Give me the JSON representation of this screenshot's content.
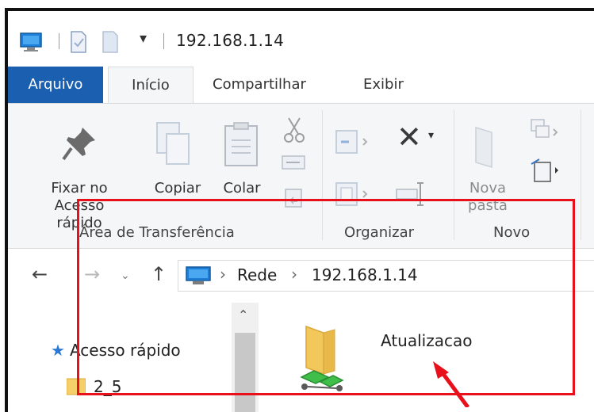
{
  "window": {
    "title": "192.168.1.14"
  },
  "tabs": {
    "file": "Arquivo",
    "home": "Início",
    "share": "Compartilhar",
    "view": "Exibir"
  },
  "ribbon": {
    "pin_line1": "Fixar no",
    "pin_line2": "Acesso rápido",
    "copy": "Copiar",
    "paste": "Colar",
    "new_folder_line1": "Nova",
    "new_folder_line2": "pasta",
    "groups": {
      "clipboard": "Área de Transferência",
      "organize": "Organizar",
      "new": "Novo"
    }
  },
  "address": {
    "crumb_network": "Rede",
    "crumb_host": "192.168.1.14"
  },
  "nav_pane": {
    "quick_access": "Acesso rápido",
    "sub_item": "2_5"
  },
  "files": {
    "item_name": "Atualizacao"
  },
  "colors": {
    "accent_blue": "#1a5fb0",
    "annotation_red": "#e8101a"
  }
}
